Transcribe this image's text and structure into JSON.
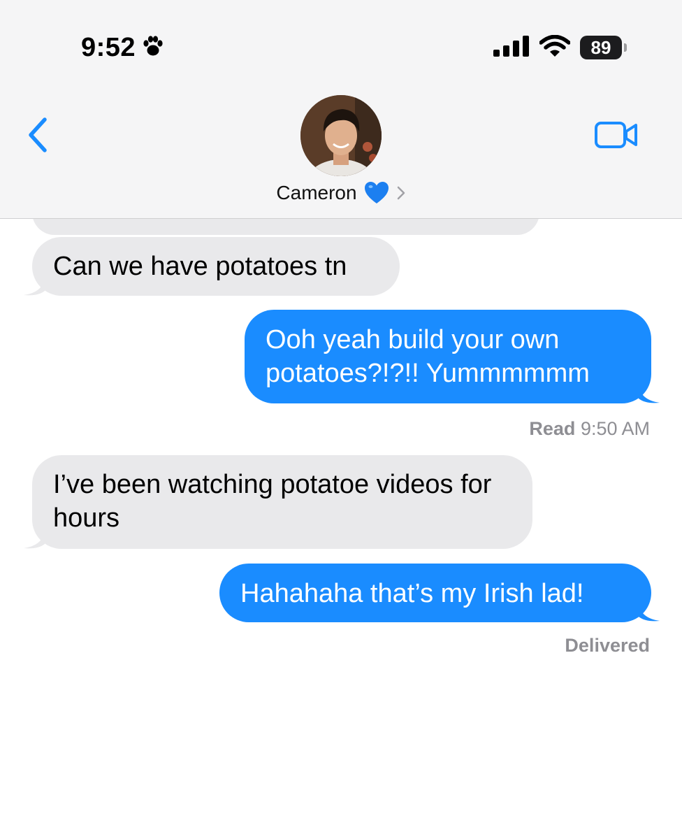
{
  "status_bar": {
    "time": "9:52",
    "battery": "89"
  },
  "header": {
    "contact_name": "Cameron",
    "heart_icon": "blue-heart-emoji"
  },
  "messages": [
    {
      "direction": "incoming",
      "text": ""
    },
    {
      "direction": "incoming",
      "text": "Can we have potatoes tn"
    },
    {
      "direction": "outgoing",
      "text": "Ooh yeah build your own potatoes?!?!! Yummmmmm"
    },
    {
      "direction": "incoming",
      "text": "I’ve been watching potatoe videos for hours"
    },
    {
      "direction": "outgoing",
      "text": "Hahahaha that’s my Irish lad!"
    }
  ],
  "receipts": {
    "read_label": "Read",
    "read_time": "9:50 AM",
    "delivered": "Delivered"
  },
  "colors": {
    "outgoing_bubble": "#1a8cff",
    "incoming_bubble": "#e9e9eb",
    "accent": "#1a8cff",
    "receipt_text": "#8e8e93"
  }
}
